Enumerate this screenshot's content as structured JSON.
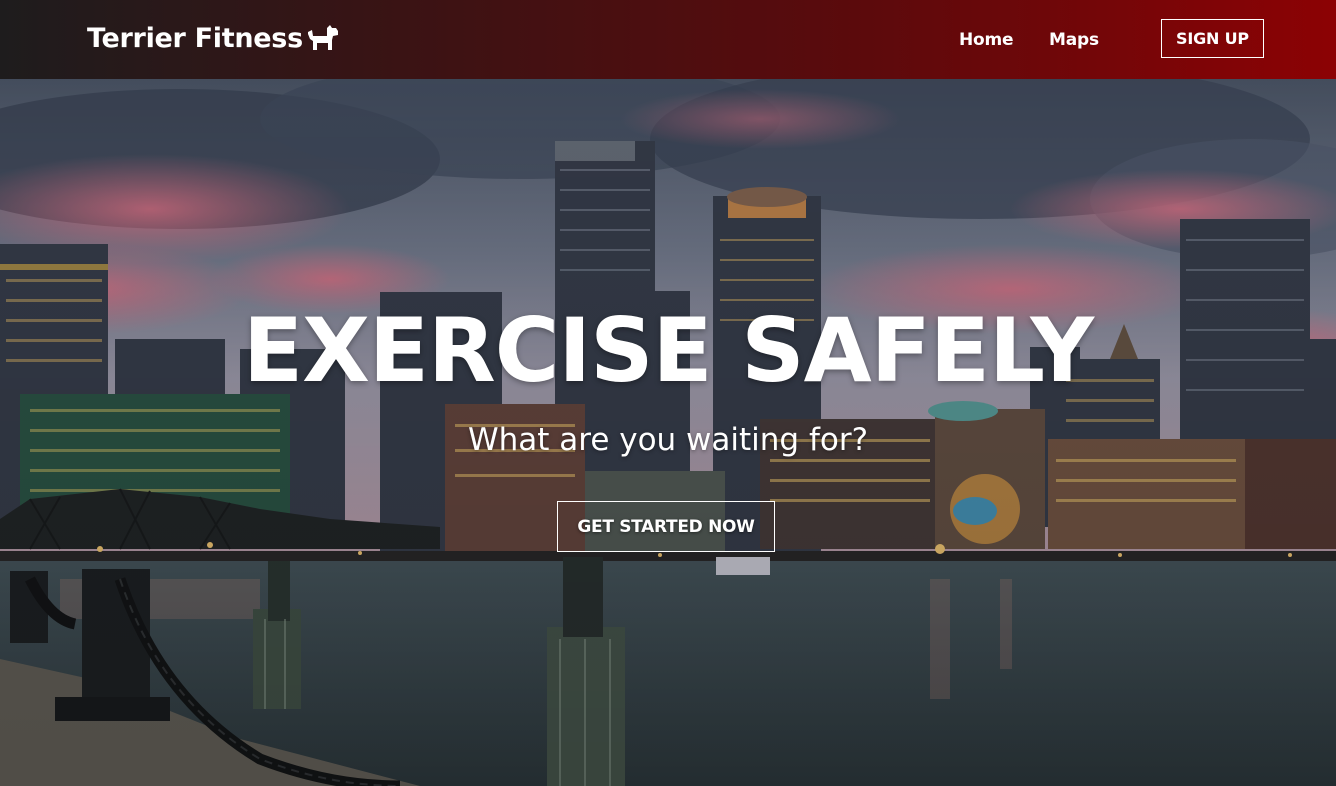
{
  "navbar": {
    "brand": "Terrier Fitness",
    "brand_icon": "dog-icon",
    "links": [
      {
        "label": "Home"
      },
      {
        "label": "Maps"
      }
    ],
    "signup_label": "SIGN UP"
  },
  "hero": {
    "title": "EXERCISE SAFELY",
    "subtitle": "What are you waiting for?",
    "cta_label": "GET STARTED NOW",
    "background": "city-skyline-harbor-dusk"
  },
  "colors": {
    "nav_gradient_start": "#1e1c1d",
    "nav_gradient_end": "#8c0204",
    "text": "#ffffff"
  }
}
